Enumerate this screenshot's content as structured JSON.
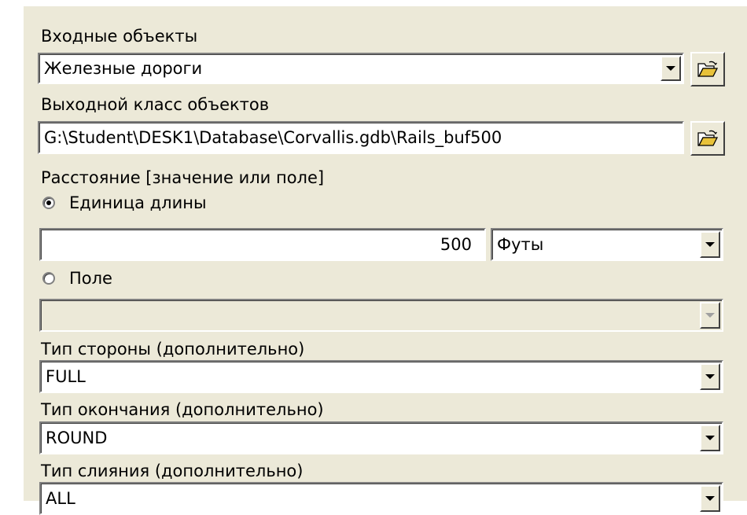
{
  "input_features": {
    "label": "Входные объекты",
    "value": "Железные дороги"
  },
  "output_class": {
    "label": "Выходной класс объектов",
    "value": "G:\\Student\\DESK1\\Database\\Corvallis.gdb\\Rails_buf500"
  },
  "distance": {
    "label": "Расстояние [значение или поле]",
    "linear_unit": {
      "label": "Единица длины",
      "selected": true,
      "value": "500",
      "unit": "Футы"
    },
    "field": {
      "label": "Поле",
      "selected": false,
      "value": ""
    }
  },
  "side_type": {
    "label": "Тип стороны (дополнительно)",
    "value": "FULL"
  },
  "end_type": {
    "label": "Тип окончания (дополнительно)",
    "value": "ROUND"
  },
  "dissolve_type": {
    "label": "Тип слияния (дополнительно)",
    "value": "ALL"
  },
  "icons": {
    "browse": "open-folder-icon",
    "dropdown": "dropdown-arrow-icon"
  }
}
